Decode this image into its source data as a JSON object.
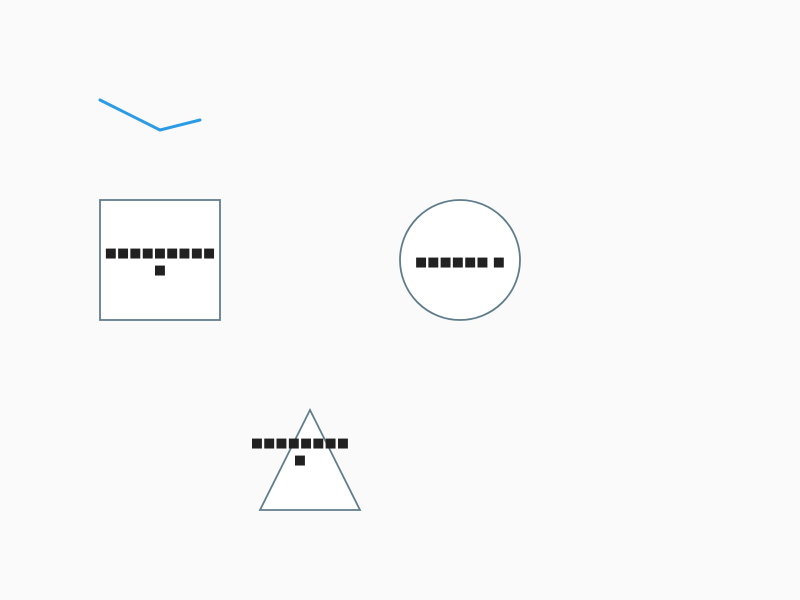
{
  "canvas": {
    "background": "#fafafa"
  },
  "colors": {
    "polyline": "#2b9be6",
    "shape_stroke": "#607d8b",
    "shape_fill": "#ffffff",
    "text": "#212121"
  },
  "polyline": {
    "name": "blue-polyline"
  },
  "square": {
    "line1": "■■■■■■■■■",
    "line2": "■"
  },
  "circle": {
    "line1": "■■■■■■ ■"
  },
  "triangle": {
    "line1": "■■■■■■■■",
    "line2": "■"
  }
}
